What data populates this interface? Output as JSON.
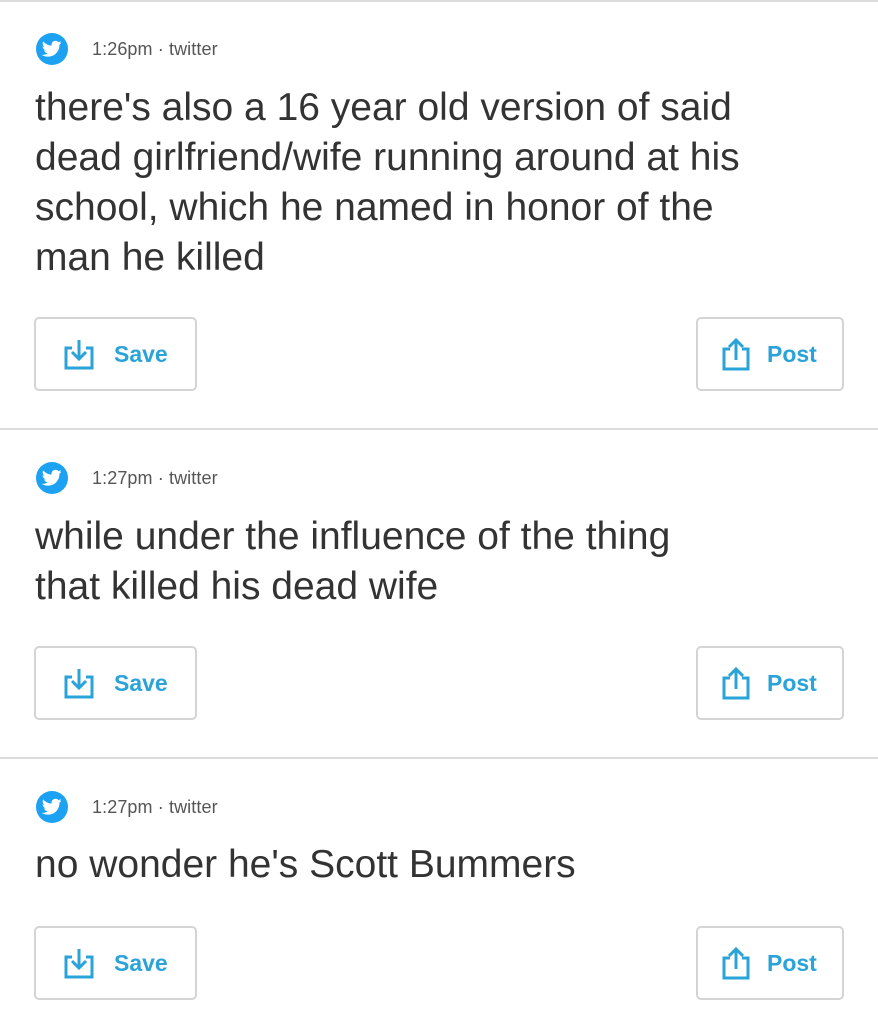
{
  "accent_color": "#2aa3d9",
  "twitter_color": "#1da1f2",
  "posts": [
    {
      "time": "1:26pm",
      "source": "twitter",
      "separator": "·",
      "text": "there's also a 16 year old version of said\ndead girlfriend/wife running around at his\nschool, which he named in honor of the\nman he killed",
      "save_label": "Save",
      "post_label": "Post",
      "source_icon": "twitter-bird-icon",
      "save_icon": "download-tray-icon",
      "post_icon": "share-up-icon"
    },
    {
      "time": "1:27pm",
      "source": "twitter",
      "separator": "·",
      "text": "while under the influence of the thing\nthat killed his dead wife",
      "save_label": "Save",
      "post_label": "Post",
      "source_icon": "twitter-bird-icon",
      "save_icon": "download-tray-icon",
      "post_icon": "share-up-icon"
    },
    {
      "time": "1:27pm",
      "source": "twitter",
      "separator": "·",
      "text": "no wonder he's Scott Bummers",
      "save_label": "Save",
      "post_label": "Post",
      "source_icon": "twitter-bird-icon",
      "save_icon": "download-tray-icon",
      "post_icon": "share-up-icon"
    }
  ]
}
